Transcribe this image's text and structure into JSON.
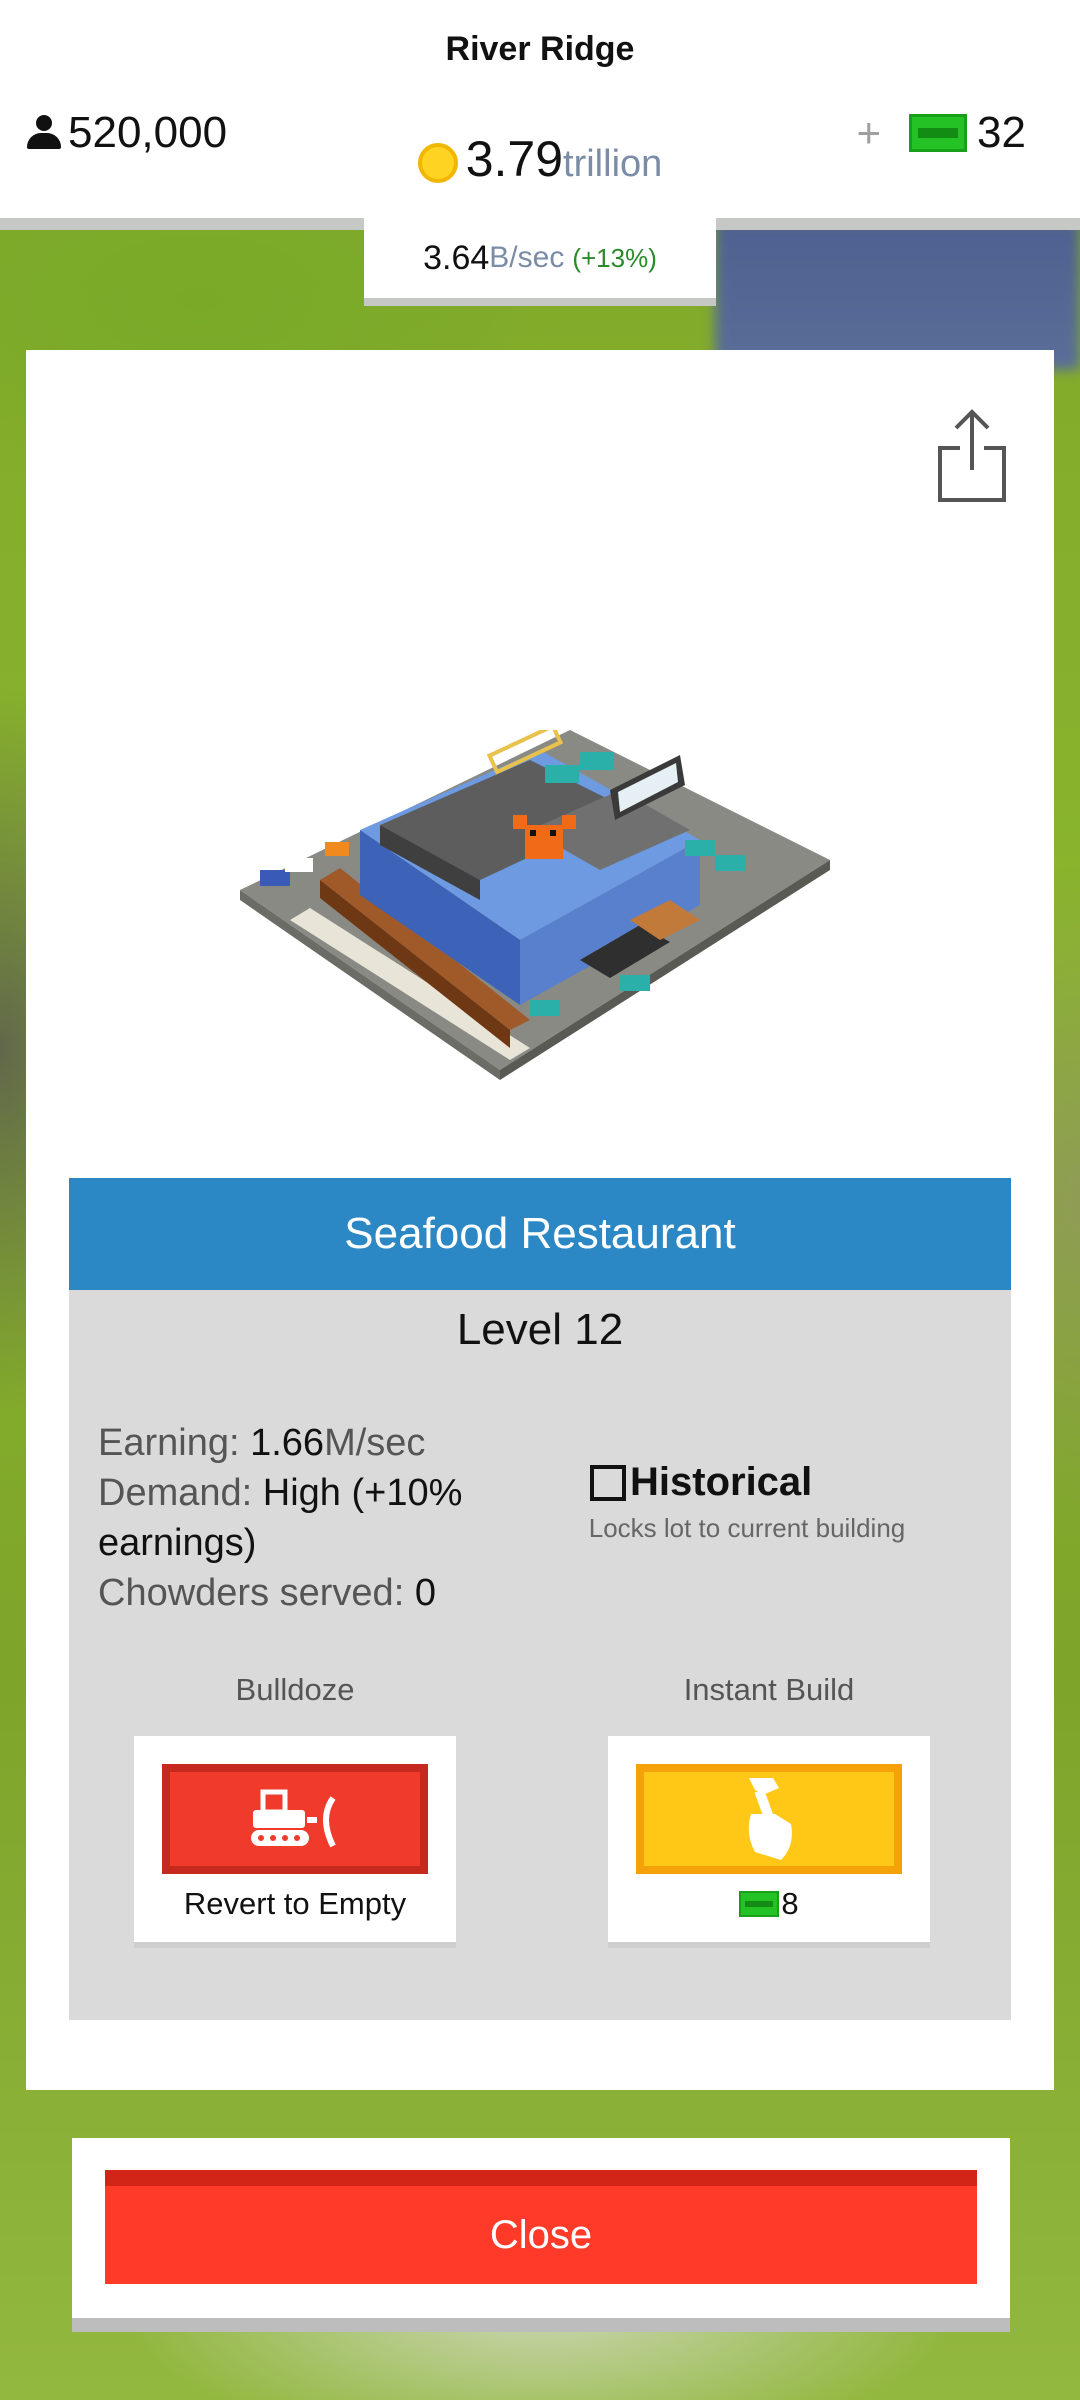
{
  "header": {
    "city_name": "River Ridge",
    "population": "520,000",
    "coins_value": "3.79",
    "coins_unit": "trillion",
    "gems_value": "32",
    "rate_value": "3.64",
    "rate_unit": "B/sec",
    "rate_change": "(+13%)"
  },
  "building": {
    "name": "Seafood Restaurant",
    "level": "Level 12",
    "earning_label": "Earning:",
    "earning_value": "1.66",
    "earning_unit": "M/sec",
    "demand_label": "Demand:",
    "demand_value": "High (+10% earnings)",
    "chowders_label": "Chowders served:",
    "chowders_value": "0"
  },
  "historical": {
    "label": "Historical",
    "description": "Locks lot to current building",
    "checked": false
  },
  "actions": {
    "bulldoze_caption": "Bulldoze",
    "revert_label": "Revert to Empty",
    "instant_caption": "Instant Build",
    "instant_cost": "8"
  },
  "close_label": "Close",
  "icons": {
    "population": "person-icon",
    "coins": "coin-icon",
    "gems": "gem-icon",
    "share": "share-icon",
    "bulldozer": "bulldozer-icon",
    "hammer": "hammer-hand-icon"
  },
  "colors": {
    "title_bar": "#2c87c5",
    "revert_button": "#f03b2c",
    "instant_button": "#ffc816",
    "close_button": "#ff3a29",
    "gem": "#24c224",
    "coin": "#ffd321"
  }
}
